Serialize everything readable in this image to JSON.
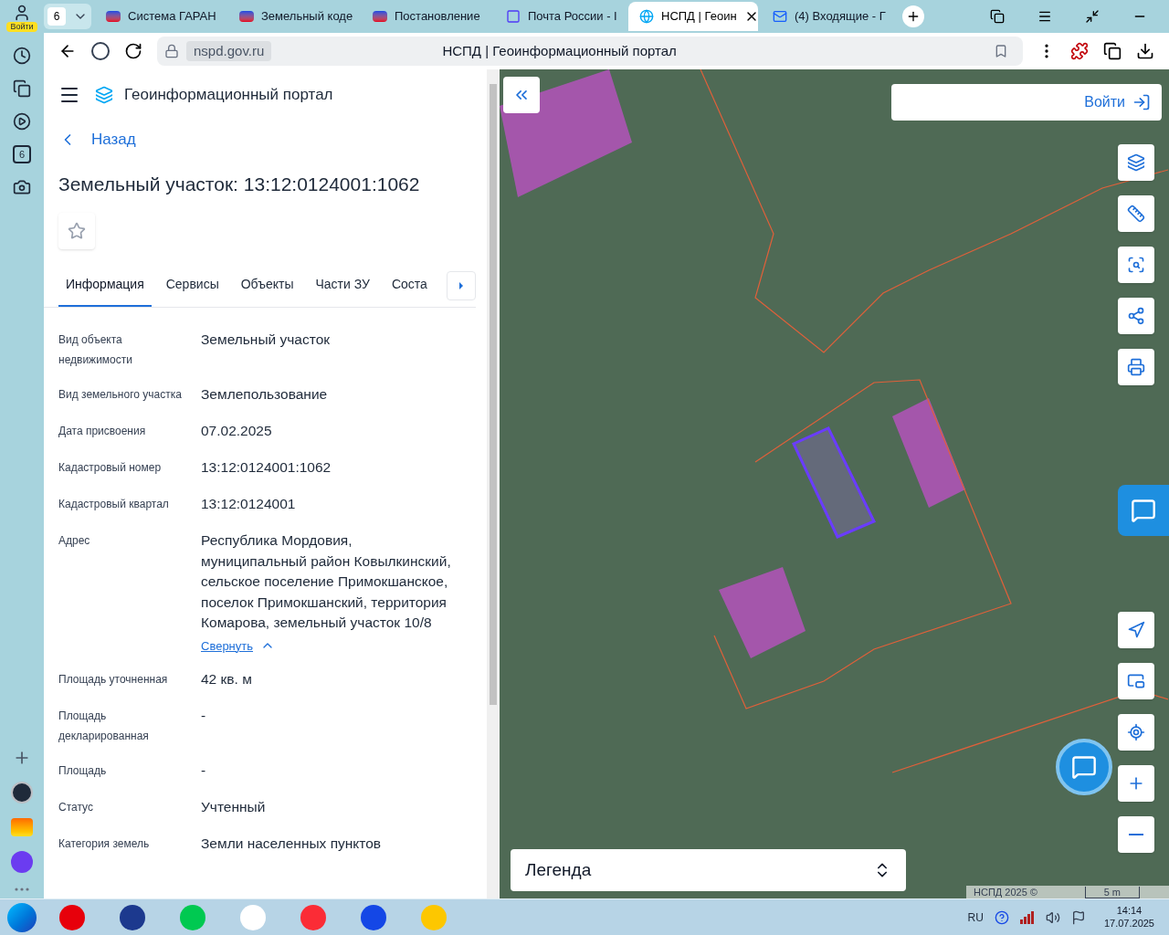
{
  "browser": {
    "profile_label": "Войти",
    "tab_count": "6",
    "rail_badge": "6",
    "tabs": [
      {
        "label": "Система ГАРАН",
        "selected": false
      },
      {
        "label": "Земельный коде",
        "selected": false
      },
      {
        "label": "Постановление",
        "selected": false
      },
      {
        "label": "Почта России - I",
        "selected": false
      },
      {
        "label": "НСПД | Геоин",
        "selected": true
      },
      {
        "label": "(4) Входящие - Г",
        "selected": false
      }
    ],
    "address": "nspd.gov.ru",
    "page_title": "НСПД | Геоинформационный портал"
  },
  "panel": {
    "brand": "Геоинформационный портал",
    "back": "Назад",
    "title": "Земельный участок: 13:12:0124001:1062",
    "tabs": [
      {
        "label": "Информация",
        "selected": true
      },
      {
        "label": "Сервисы",
        "selected": false
      },
      {
        "label": "Объекты",
        "selected": false
      },
      {
        "label": "Части ЗУ",
        "selected": false
      },
      {
        "label": "Соста",
        "selected": false
      }
    ],
    "fields": [
      {
        "label": "Вид объекта недвижимости",
        "value": "Земельный участок"
      },
      {
        "label": "Вид земельного участка",
        "value": "Землепользование"
      },
      {
        "label": "Дата присвоения",
        "value": "07.02.2025"
      },
      {
        "label": "Кадастровый номер",
        "value": "13:12:0124001:1062"
      },
      {
        "label": "Кадастровый квартал",
        "value": "13:12:0124001"
      },
      {
        "label": "Адрес",
        "value": "Республика Мордовия, муниципальный район Ковылкинский, сельское поселение Примокшанское, поселок Примокшанский, территория Комарова, земельный участок 10/8",
        "toggle": "Свернуть"
      },
      {
        "label": "Площадь уточненная",
        "value": "42 кв. м"
      },
      {
        "label": "Площадь декларированная",
        "value": "-"
      },
      {
        "label": "Площадь",
        "value": "-"
      },
      {
        "label": "Статус",
        "value": "Учтенный"
      },
      {
        "label": "Категория земель",
        "value": "Земли населенных пунктов"
      }
    ]
  },
  "map": {
    "login": "Войти",
    "legend": "Легенда",
    "copyright": "НСПД 2025 ©",
    "scale": "5 m"
  },
  "taskbar": {
    "language": "RU",
    "time": "14:14",
    "date": "17.07.2025"
  }
}
